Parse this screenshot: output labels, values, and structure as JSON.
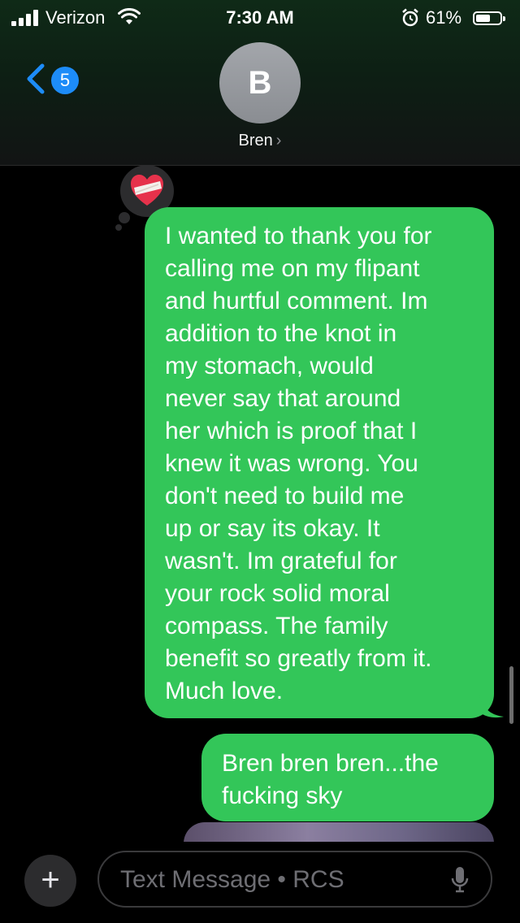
{
  "status_bar": {
    "carrier": "Verizon",
    "time": "7:30 AM",
    "battery_percent": "61%",
    "battery_level": 0.61
  },
  "nav": {
    "unread_count": "5",
    "avatar_initial": "B",
    "contact_name": "Bren",
    "chevron": "›"
  },
  "conversation": {
    "tapback_icon": "mending-heart-icon",
    "messages": [
      {
        "direction": "outgoing",
        "lines": [
          "I wanted to thank you for",
          "calling me on my flipant",
          "and hurtful comment. Im",
          "addition to the knot in",
          "my stomach, would",
          "never say that around",
          "her which is proof that I",
          "knew it was wrong. You",
          "don't need to build me",
          "up or say its okay. It",
          "wasn't. Im grateful for",
          "your rock solid moral",
          "compass. The family",
          "benefit so greatly from it.",
          "Much love."
        ]
      },
      {
        "direction": "outgoing",
        "lines": [
          "Bren bren bren...the",
          "fucking sky"
        ]
      }
    ]
  },
  "composer": {
    "plus_label": "+",
    "placeholder": "Text Message • RCS"
  },
  "colors": {
    "bubble_green": "#33c659",
    "badge_blue": "#1d8cf8",
    "background": "#000000"
  }
}
